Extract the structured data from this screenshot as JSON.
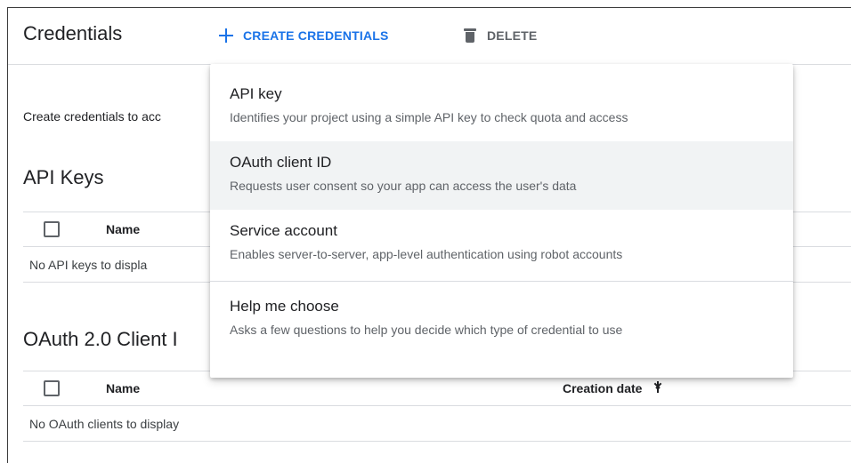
{
  "header": {
    "title": "Credentials",
    "create_label": "CREATE CREDENTIALS",
    "delete_label": "DELETE"
  },
  "intro_text": "Create credentials to acc",
  "api_keys": {
    "title": "API Keys",
    "columns": {
      "name": "Name"
    },
    "empty_text": "No API keys to displa"
  },
  "oauth": {
    "title": "OAuth 2.0 Client I",
    "columns": {
      "name": "Name",
      "creation_date": "Creation date"
    },
    "empty_text": "No OAuth clients to display"
  },
  "menu": {
    "items": [
      {
        "title": "API key",
        "description": "Identifies your project using a simple API key to check quota and access"
      },
      {
        "title": "OAuth client ID",
        "description": "Requests user consent so your app can access the user's data"
      },
      {
        "title": "Service account",
        "description": "Enables server-to-server, app-level authentication using robot accounts"
      },
      {
        "title": "Help me choose",
        "description": "Asks a few questions to help you decide which type of credential to use"
      }
    ]
  },
  "colors": {
    "accent": "#1a73e8",
    "hover_bg": "#f1f3f4"
  },
  "icons": {
    "create": "plus-icon",
    "delete": "trash-icon",
    "sort": "arrow-down-icon"
  }
}
